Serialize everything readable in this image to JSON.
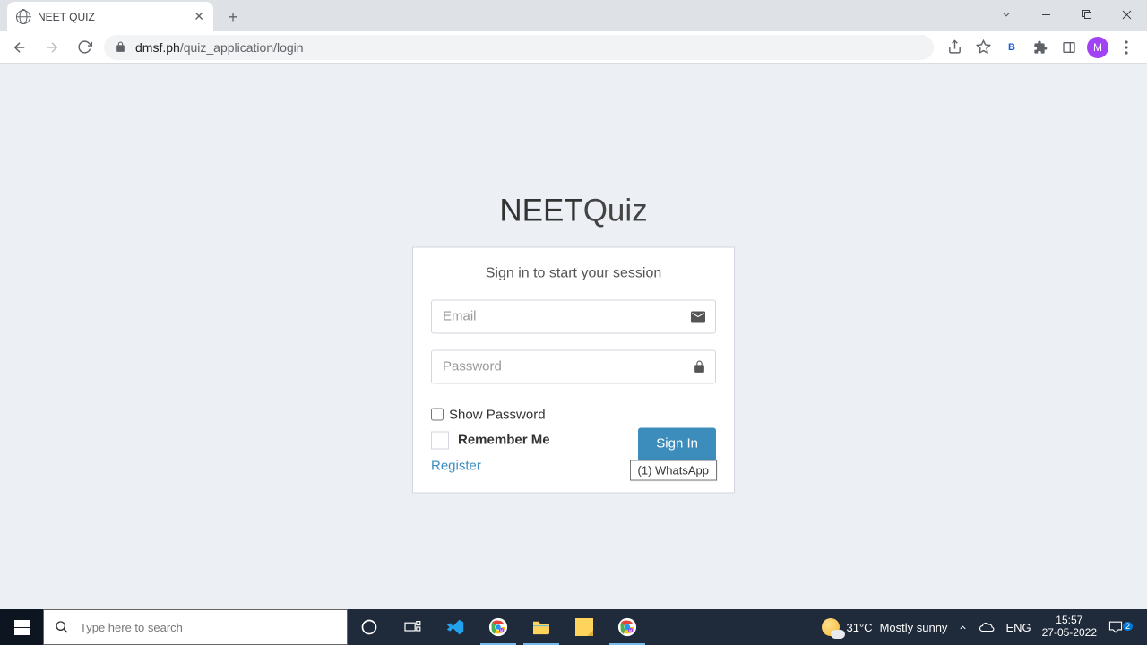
{
  "browser": {
    "tab_title": "NEET QUIZ",
    "url_host": "dmsf.ph",
    "url_path": "/quiz_application/login",
    "bitwarden_label": "B",
    "avatar_letter": "M"
  },
  "page": {
    "logo_bold": "NEET",
    "logo_light": "Quiz",
    "subtitle": "Sign in to start your session",
    "email_placeholder": "Email",
    "password_placeholder": "Password",
    "show_password_label": "Show Password",
    "remember_label": "Remember Me",
    "signin_label": "Sign In",
    "register_label": "Register",
    "tooltip_text": "(1) WhatsApp"
  },
  "taskbar": {
    "search_placeholder": "Type here to search",
    "temp": "31°C",
    "weather_text": "Mostly sunny",
    "lang": "ENG",
    "time": "15:57",
    "date": "27-05-2022",
    "notif_count": "2"
  }
}
